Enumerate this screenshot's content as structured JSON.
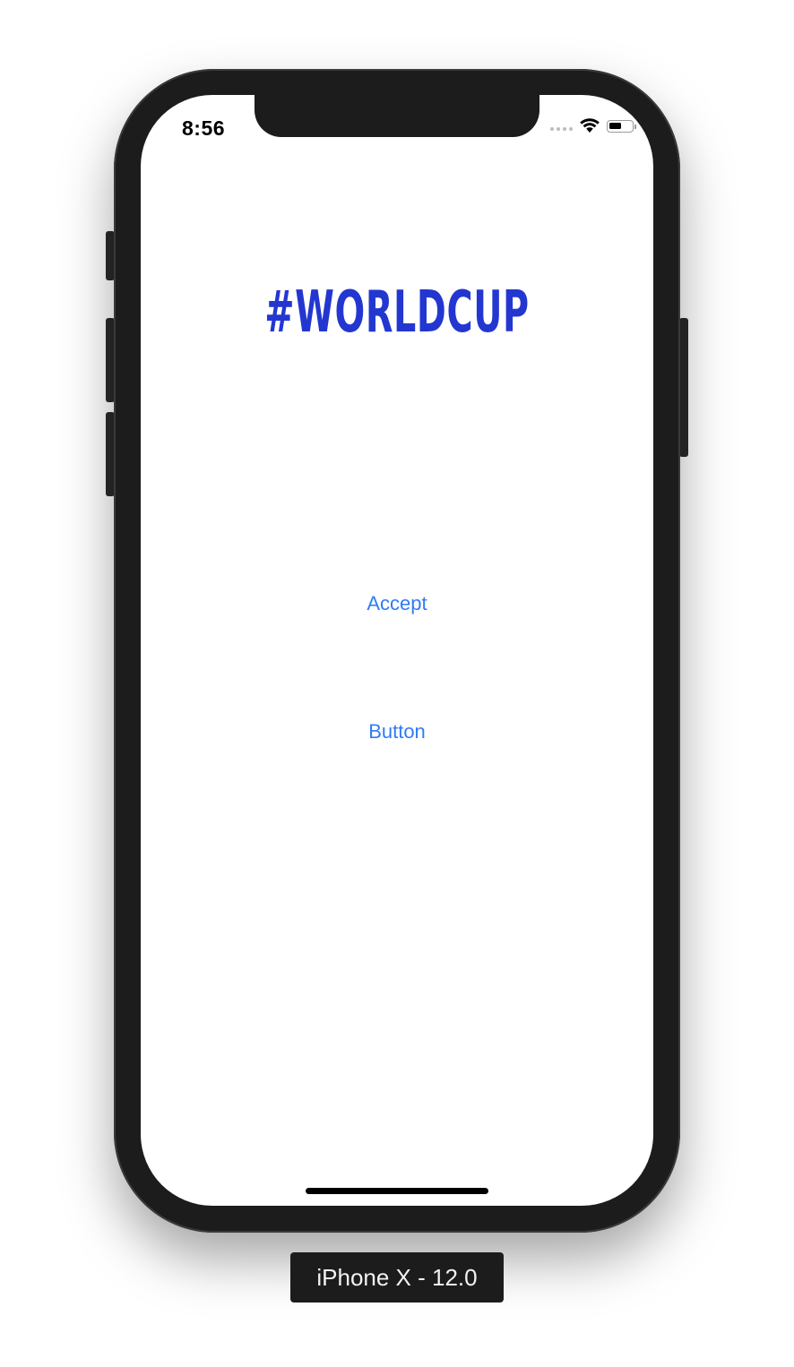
{
  "status_bar": {
    "time": "8:56",
    "battery_level": 0.55
  },
  "app": {
    "headline": "#WORLDCUP",
    "accept_label": "Accept",
    "button_label": "Button"
  },
  "simulator": {
    "device_label": "iPhone X - 12.0"
  },
  "colors": {
    "headline": "#2337d0",
    "button_tint": "#2f7cf6",
    "device_frame": "#1c1c1c"
  }
}
